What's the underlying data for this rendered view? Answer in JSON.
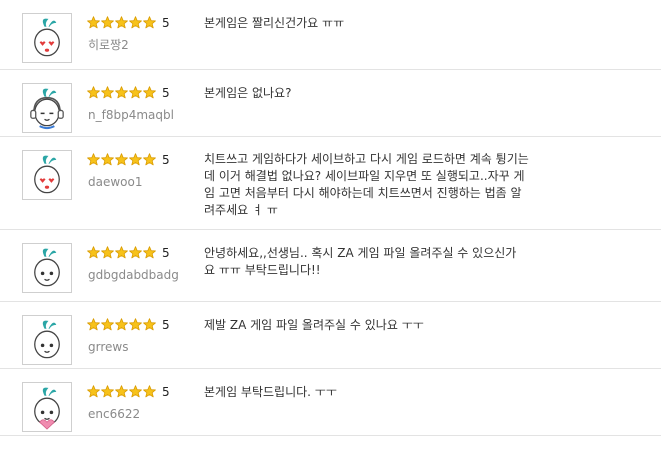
{
  "colors": {
    "star": "#f7c21a",
    "star_edge": "#d99b00",
    "divider": "#e3e3e3",
    "username": "#8a8a8a"
  },
  "reviews": [
    {
      "username": "히로짱2",
      "rating": "5",
      "avatar": "red-heart-eyes-face-icon",
      "comment": [
        "본게임은 짤리신건가요 ㅠㅠ"
      ]
    },
    {
      "username": "n_f8bp4maqbl",
      "rating": "5",
      "avatar": "headphones-face-icon",
      "comment": [
        "본게임은 없나요?"
      ]
    },
    {
      "username": "daewoo1",
      "rating": "5",
      "avatar": "red-heart-eyes-face-icon",
      "comment": [
        "치트쓰고 게임하다가 세이브하고 다시 게임 로드하면 계속 튕기는",
        "데 이거 해결법 없나요? 세이브파일 지우면 또 실행되고..자꾸 게",
        "임 고면 처음부터 다시 해야하는데 치트쓰면서 진행하는 법좀 알",
        "려주세요 ㅕ ㅠ"
      ]
    },
    {
      "username": "gdbgdabdbadg",
      "rating": "5",
      "avatar": "plain-face-icon",
      "comment": [
        "안녕하세요,,선생님.. 혹시 ZA 게임 파일 올려주실 수 있으신가",
        "요 ㅠㅠ 부탁드립니다!!"
      ]
    },
    {
      "username": "grrews",
      "rating": "5",
      "avatar": "plain-face-icon",
      "comment": [
        "제발 ZA 게임 파일 올려주실 수 있나요 ㅜㅜ"
      ]
    },
    {
      "username": "enc6622",
      "rating": "5",
      "avatar": "heart-hands-face-icon",
      "comment": [
        "본게임 부탁드립니다. ㅜㅜ"
      ]
    }
  ]
}
